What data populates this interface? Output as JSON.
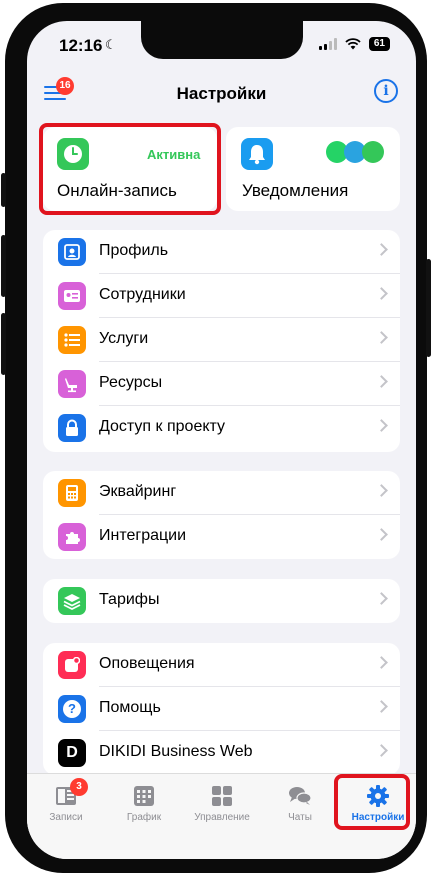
{
  "status_bar": {
    "time": "12:16",
    "battery": "61"
  },
  "nav": {
    "title": "Настройки",
    "menu_badge": "16"
  },
  "top_cards": {
    "online": {
      "label": "Онлайн-запись",
      "status": "Активна"
    },
    "notifications": {
      "label": "Уведомления"
    }
  },
  "groups": [
    {
      "items": [
        {
          "label": "Профиль",
          "icon": "profile-icon",
          "color": "#1a73e8"
        },
        {
          "label": "Сотрудники",
          "icon": "contact-card-icon",
          "color": "#d861d8"
        },
        {
          "label": "Услуги",
          "icon": "list-icon",
          "color": "#ff9500"
        },
        {
          "label": "Ресурсы",
          "icon": "dental-chair-icon",
          "color": "#d861d8"
        },
        {
          "label": "Доступ к проекту",
          "icon": "lock-icon",
          "color": "#1a73e8"
        }
      ]
    },
    {
      "items": [
        {
          "label": "Эквайринг",
          "icon": "card-terminal-icon",
          "color": "#ff9500"
        },
        {
          "label": "Интеграции",
          "icon": "puzzle-icon",
          "color": "#d861d8"
        }
      ]
    },
    {
      "items": [
        {
          "label": "Тарифы",
          "icon": "layers-icon",
          "color": "#34c759"
        }
      ]
    },
    {
      "items": [
        {
          "label": "Оповещения",
          "icon": "notification-icon",
          "color": "#ff2d55"
        },
        {
          "label": "Помощь",
          "icon": "help-icon",
          "color": "#1a73e8"
        },
        {
          "label": "DIKIDI Business Web",
          "icon": "dikidi-logo-icon",
          "color": "#000000"
        }
      ]
    }
  ],
  "tabbar": {
    "tabs": [
      {
        "label": "Записи",
        "badge": "3"
      },
      {
        "label": "График"
      },
      {
        "label": "Управление"
      },
      {
        "label": "Чаты"
      },
      {
        "label": "Настройки",
        "active": true
      }
    ]
  },
  "colors": {
    "accent": "#1a73e8",
    "active_green": "#34c759",
    "highlight": "#e0141e",
    "badge": "#ff3b30"
  }
}
